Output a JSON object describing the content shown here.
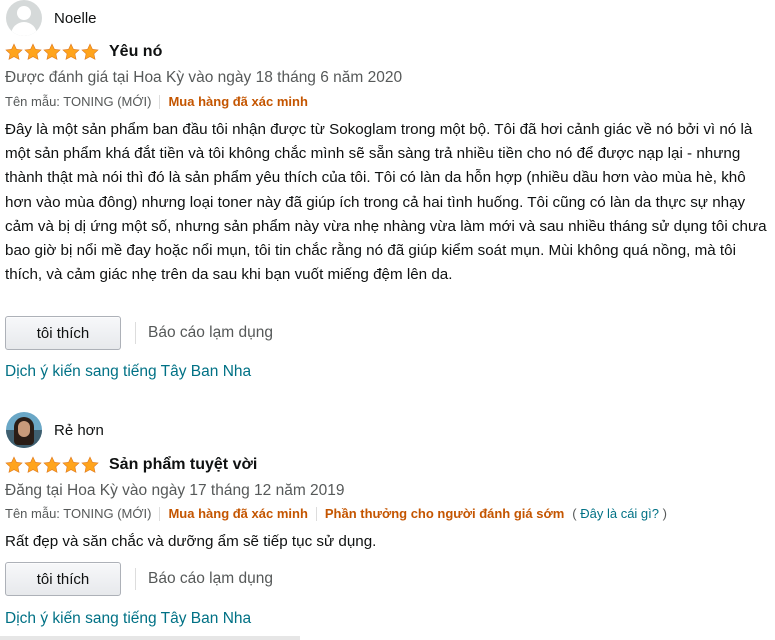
{
  "colors": {
    "star": "#ffa41c",
    "verified": "#c45500",
    "link": "#007185",
    "muted": "#565959"
  },
  "reviews": [
    {
      "username": "Noelle",
      "avatar_icon": "default-user-avatar",
      "rating": 5,
      "title": "Yêu nó",
      "date_text": "Được đánh giá tại Hoa Kỳ vào ngày 18 tháng 6 năm 2020",
      "model": "Tên mẫu: TONING (MỚI)",
      "verified": "Mua hàng đã xác minh",
      "body": "Đây là một sản phẩm ban đầu tôi nhận được từ Sokoglam trong một bộ. Tôi đã hơi cảnh giác về nó bởi vì nó là một sản phẩm khá đắt tiền và tôi không chắc mình sẽ sẵn sàng trả nhiều tiền cho nó để được nạp lại - nhưng thành thật mà nói thì đó là sản phẩm yêu thích của tôi. Tôi có làn da hỗn hợp (nhiều dầu hơn vào mùa hè, khô hơn vào mùa đông) nhưng loại toner này đã giúp ích trong cả hai tình huống. Tôi cũng có làn da thực sự nhạy cảm và bị dị ứng một số, nhưng sản phẩm này vừa nhẹ nhàng vừa làm mới và sau nhiều tháng sử dụng tôi chưa bao giờ bị nổi mề đay hoặc nổi mụn, tôi tin chắc rằng nó đã giúp kiểm soát mụn. Mùi không quá nồng, mà tôi thích, và cảm giác nhẹ trên da sau khi bạn vuốt miếng đệm lên da.",
      "helpful_label": "tôi thích",
      "report_label": "Báo cáo lạm dụng",
      "translate_label": "Dịch ý kiến sang tiếng Tây Ban Nha"
    },
    {
      "username": "Rẻ hơn",
      "avatar_icon": "user-photo-avatar",
      "rating": 5,
      "title": "Sản phẩm tuyệt vời",
      "date_text": "Đăng tại Hoa Kỳ vào ngày 17 tháng 12 năm 2019",
      "model": "Tên mẫu: TONING (MỚI)",
      "verified": "Mua hàng đã xác minh",
      "vine": "Phần thưởng cho người đánh giá sớm",
      "whats_this": "Đây là cái gì?",
      "body": "Rất đẹp và săn chắc và dưỡng ẩm sẽ tiếp tục sử dụng.",
      "helpful_label": "tôi thích",
      "report_label": "Báo cáo lạm dụng",
      "translate_label": "Dịch ý kiến sang tiếng Tây Ban Nha"
    }
  ]
}
